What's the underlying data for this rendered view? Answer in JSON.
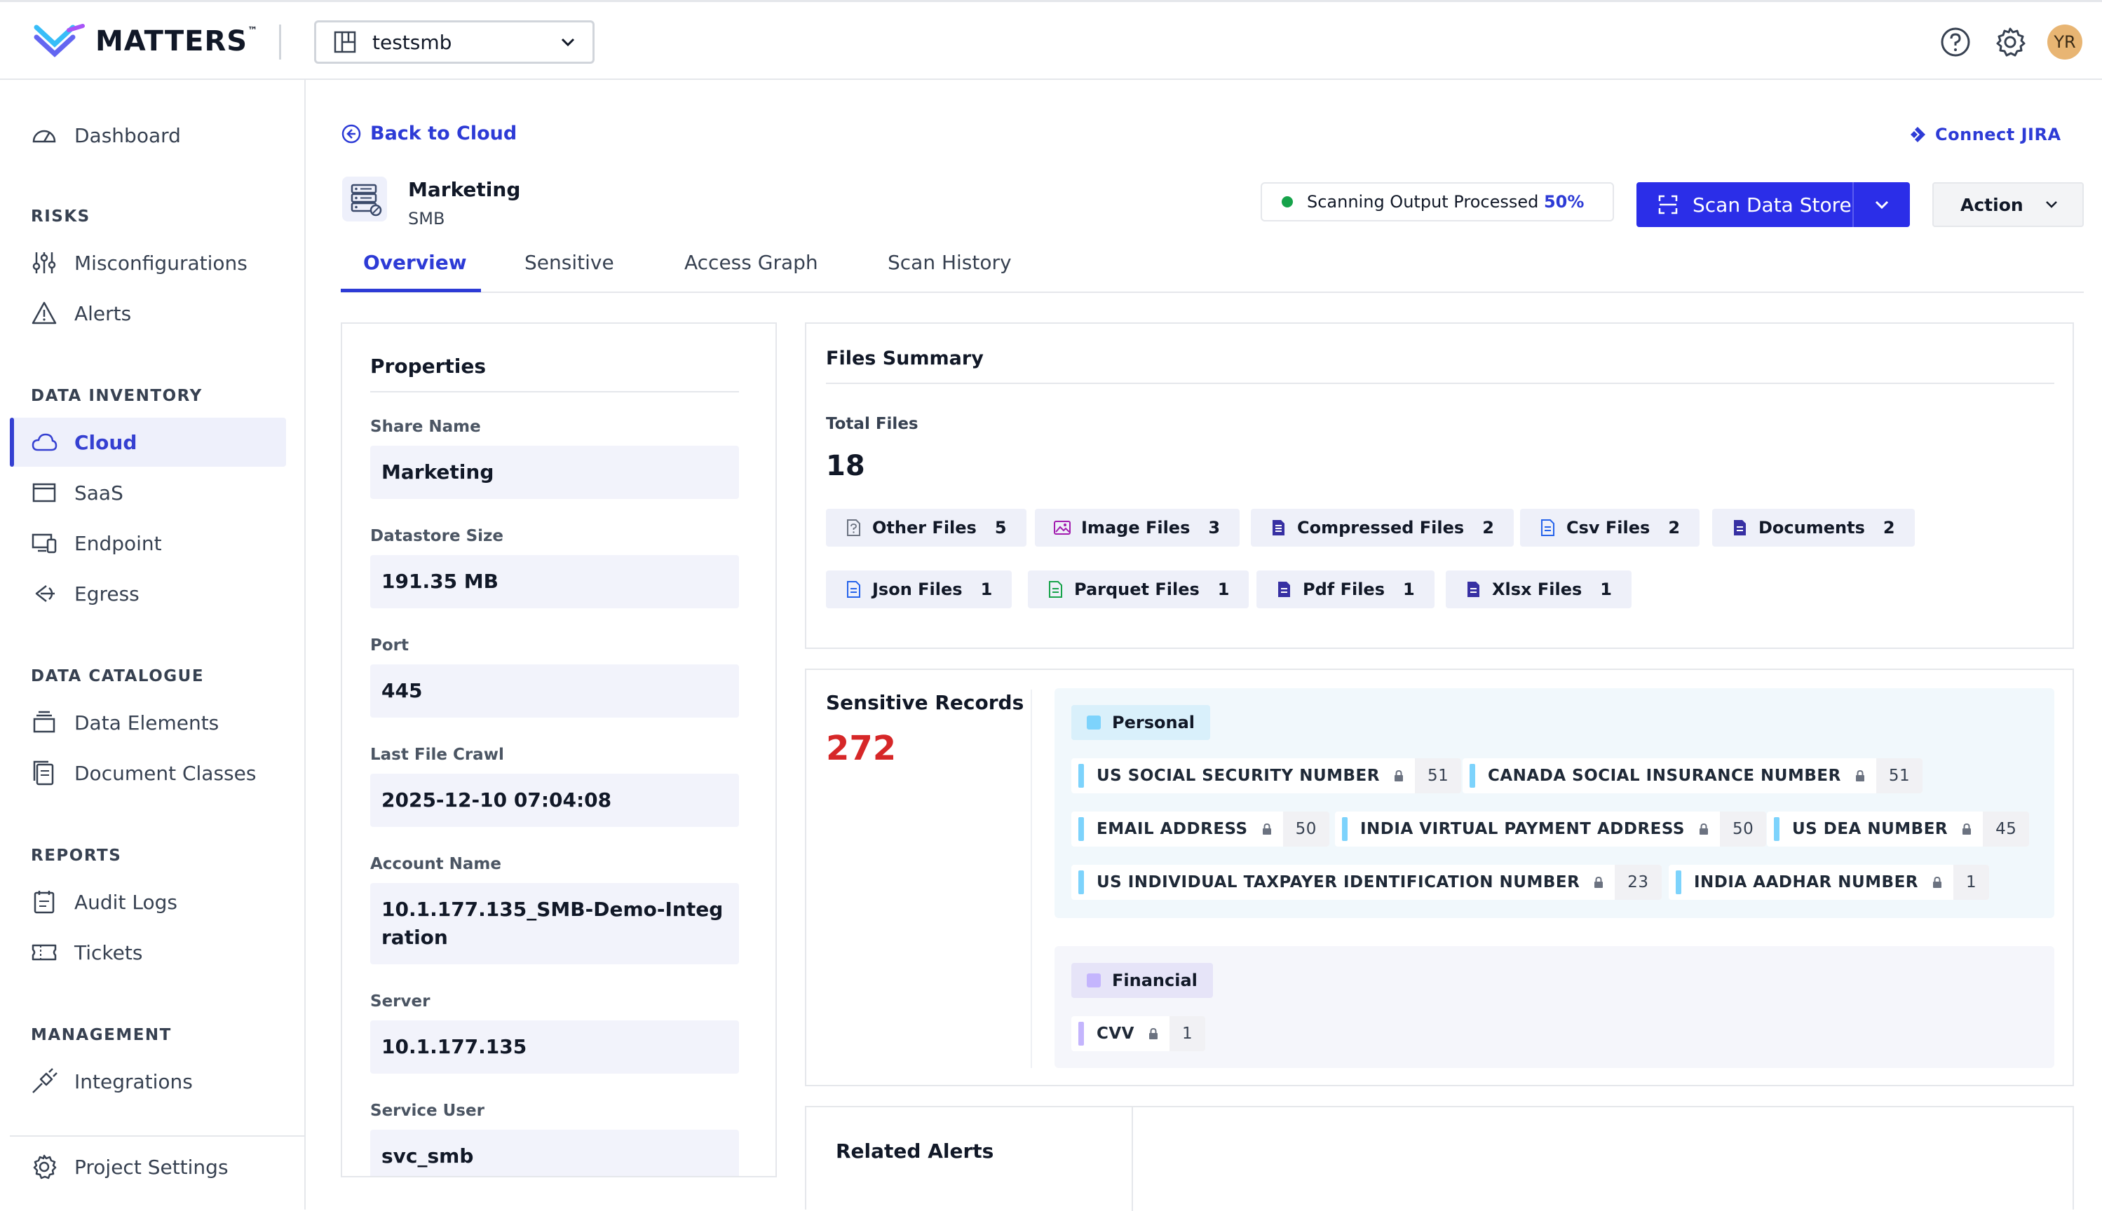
{
  "brand": {
    "name": "MATTERS",
    "tm": "™"
  },
  "header": {
    "project": "testsmb",
    "avatar_initials": "YR"
  },
  "sidebar": {
    "dashboard": "Dashboard",
    "sections": {
      "risks": "RISKS",
      "inventory": "DATA INVENTORY",
      "catalogue": "DATA CATALOGUE",
      "reports": "REPORTS",
      "management": "MANAGEMENT"
    },
    "items": {
      "misconfigurations": "Misconfigurations",
      "alerts": "Alerts",
      "cloud": "Cloud",
      "saas": "SaaS",
      "endpoint": "Endpoint",
      "egress": "Egress",
      "data_elements": "Data Elements",
      "document_classes": "Document Classes",
      "audit_logs": "Audit Logs",
      "tickets": "Tickets",
      "integrations": "Integrations",
      "project_settings": "Project Settings"
    }
  },
  "main": {
    "back_label": "Back to Cloud",
    "connect_label": "Connect JIRA",
    "datastore": {
      "name": "Marketing",
      "type": "SMB"
    },
    "scan_status": {
      "label": "Scanning Output Processed",
      "percent": "50%"
    },
    "scan_button": "Scan Data Store",
    "action_button": "Action",
    "tabs": [
      "Overview",
      "Sensitive",
      "Access Graph",
      "Scan History"
    ]
  },
  "properties": {
    "title": "Properties",
    "fields": [
      {
        "label": "Share Name",
        "value": "Marketing"
      },
      {
        "label": "Datastore Size",
        "value": "191.35 MB"
      },
      {
        "label": "Port",
        "value": "445"
      },
      {
        "label": "Last File Crawl",
        "value": "2025-12-10 07:04:08"
      },
      {
        "label": "Account Name",
        "value": "10.1.177.135_SMB-Demo-Integration"
      },
      {
        "label": "Server",
        "value": "10.1.177.135"
      },
      {
        "label": "Service User",
        "value": "svc_smb"
      }
    ]
  },
  "files_summary": {
    "title": "Files Summary",
    "total_label": "Total Files",
    "total": "18",
    "types": [
      {
        "label": "Other Files",
        "count": "5",
        "icon": "file-question-icon",
        "color": "#6b7280"
      },
      {
        "label": "Image Files",
        "count": "3",
        "icon": "image-icon",
        "color": "#a21caf"
      },
      {
        "label": "Compressed Files",
        "count": "2",
        "icon": "archive-icon",
        "color": "#3730a3"
      },
      {
        "label": "Csv Files",
        "count": "2",
        "icon": "csv-file-icon",
        "color": "#2563eb"
      },
      {
        "label": "Documents",
        "count": "2",
        "icon": "document-icon",
        "color": "#3730a3"
      },
      {
        "label": "Json Files",
        "count": "1",
        "icon": "json-file-icon",
        "color": "#2563eb"
      },
      {
        "label": "Parquet Files",
        "count": "1",
        "icon": "parquet-file-icon",
        "color": "#16a34a"
      },
      {
        "label": "Pdf Files",
        "count": "1",
        "icon": "pdf-file-icon",
        "color": "#3730a3"
      },
      {
        "label": "Xlsx Files",
        "count": "1",
        "icon": "xlsx-file-icon",
        "color": "#3730a3"
      }
    ]
  },
  "sensitive_records": {
    "title": "Sensitive Records",
    "total": "272",
    "categories": [
      {
        "name": "Personal",
        "color": "#7dd3fc",
        "records": [
          {
            "label": "US SOCIAL SECURITY NUMBER",
            "count": "51"
          },
          {
            "label": "CANADA SOCIAL INSURANCE NUMBER",
            "count": "51"
          },
          {
            "label": "EMAIL ADDRESS",
            "count": "50"
          },
          {
            "label": "INDIA VIRTUAL PAYMENT ADDRESS",
            "count": "50"
          },
          {
            "label": "US DEA NUMBER",
            "count": "45"
          },
          {
            "label": "US INDIVIDUAL TAXPAYER IDENTIFICATION NUMBER",
            "count": "23"
          },
          {
            "label": "INDIA AADHAR NUMBER",
            "count": "1"
          }
        ]
      },
      {
        "name": "Financial",
        "color": "#c4b5fd",
        "records": [
          {
            "label": "CVV",
            "count": "1"
          }
        ]
      }
    ]
  },
  "related_alerts": {
    "title": "Related Alerts"
  }
}
